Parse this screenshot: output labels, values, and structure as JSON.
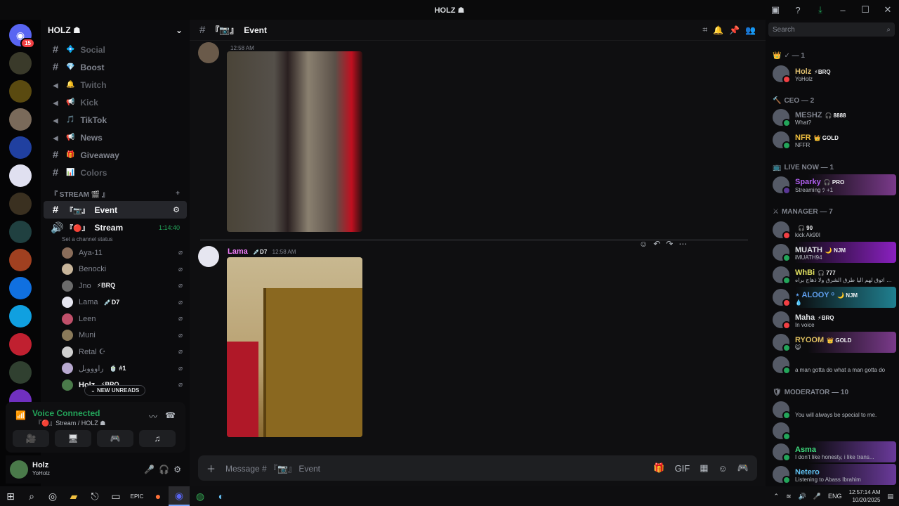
{
  "window": {
    "title": "HOLZ ☗"
  },
  "servers": {
    "discord_badge": "15",
    "items": [
      "home",
      "holz",
      "nfr",
      "server-3",
      "server-4",
      "server-5",
      "server-6",
      "server-7",
      "server-8",
      "server-9",
      "server-10",
      "server-11",
      "server-12",
      "server-13",
      "server-14",
      "server-15",
      "server-16",
      "server-17"
    ]
  },
  "guild": {
    "name": "HOLZ ☗"
  },
  "channels": [
    {
      "icon": "#",
      "emoji": "💠",
      "name": "Social",
      "active": false,
      "dim": true
    },
    {
      "icon": "#",
      "emoji": "💎",
      "name": "Boost",
      "active": false,
      "dim": false
    },
    {
      "icon": "📢",
      "emoji": "🔔",
      "name": "Twitch",
      "active": false,
      "dim": true
    },
    {
      "icon": "📢",
      "emoji": "📢",
      "name": "Kick",
      "active": false,
      "dim": true
    },
    {
      "icon": "📢",
      "emoji": "🎵",
      "name": "TikTok",
      "active": false,
      "dim": false
    },
    {
      "icon": "📢",
      "emoji": "📢",
      "name": "News",
      "active": false,
      "dim": false
    },
    {
      "icon": "#",
      "emoji": "🎁",
      "name": "Giveaway",
      "active": false,
      "dim": false
    },
    {
      "icon": "#",
      "emoji": "📊",
      "name": "Colors",
      "active": false,
      "dim": true
    }
  ],
  "stream_category": "『 STREAM 🎬 』",
  "event_channel": {
    "name": "Event",
    "prefix": "『📷』"
  },
  "stream_channel": {
    "name": "Stream",
    "prefix": "『🔴』",
    "time": "1:14:40",
    "status": "Set a channel status"
  },
  "voice_users": [
    {
      "name": "Aya-11",
      "tag": "",
      "color": "#8a6d5a"
    },
    {
      "name": "Benocki",
      "tag": "",
      "color": "#c8b59a"
    },
    {
      "name": "Jno",
      "tag": "⚡BRQ",
      "color": "#6b6b6b"
    },
    {
      "name": "Lama",
      "tag": "💉D7",
      "color": "#e6e6f0"
    },
    {
      "name": "Leen",
      "tag": "",
      "color": "#c0506a"
    },
    {
      "name": "Muni",
      "tag": "",
      "color": "#8a7a5a"
    },
    {
      "name": "Retal ☪︎",
      "tag": "",
      "color": "#d0d0d0"
    },
    {
      "name": "راوووبل",
      "tag": "🍵 #1",
      "color": "#b8a9d0"
    },
    {
      "name": "Holz",
      "tag": "⚡BRQ",
      "color": "#4a7a4a"
    }
  ],
  "new_unreads": "NEW UNREADS",
  "voice_connected": {
    "title": "Voice Connected",
    "subtitle": "『🔴』Stream / HOLZ ☗"
  },
  "user_panel": {
    "name": "Holz",
    "status": "YoHolz"
  },
  "header": {
    "channel": "Event",
    "prefix": "『📷』"
  },
  "messages": [
    {
      "time": "12:58 AM",
      "author": "",
      "avatar_color": "#6a5a4a"
    },
    {
      "time": "12:58 AM",
      "author": "Lama",
      "tag": "💉D7",
      "avatar_color": "#e6e6f0"
    }
  ],
  "composer": {
    "placeholder": "Message # 『📷』 Event"
  },
  "search": {
    "placeholder": "Search"
  },
  "members": {
    "groups": [
      {
        "label": "✓ — 1",
        "icon": "👑"
      },
      {
        "label": "CEO — 2",
        "icon": "🔨"
      },
      {
        "label": "LIVE NOW — 1",
        "icon": "📺"
      },
      {
        "label": "MANAGER — 7",
        "icon": "⚔"
      },
      {
        "label": "MODERATOR — 10",
        "icon": "🛡"
      }
    ],
    "list": [
      {
        "name": "Holz",
        "tag": "⚡BRQ",
        "sub": "YoHolz",
        "color": "#e0c070",
        "st": "#f23f43"
      },
      {
        "name": "MESHZ",
        "tag": "🎧 8888",
        "sub": "What?",
        "color": "#80848e",
        "st": "#23a55a"
      },
      {
        "name": "NFR",
        "tag": "👑 GOLD",
        "sub": "NFFR",
        "color": "#f0c040",
        "st": "#23a55a"
      },
      {
        "name": "Sparky",
        "tag": "🎧 PRO",
        "sub": "Streaming ﾂ +1",
        "color": "#b060f0",
        "st": "#593695"
      },
      {
        "name": "",
        "tag": "🎧 90",
        "sub": "kick Ak90I",
        "color": "#80848e",
        "st": "#f23f43"
      },
      {
        "name": "MUATH",
        "tag": "🌙 NJM",
        "sub": "iMUATH94",
        "color": "#dbdee1",
        "st": "#23a55a"
      },
      {
        "name": "WhBi",
        "tag": "🎧 777",
        "sub": "يم اني اتوق لهم اليا طرق الشرق ولا ذهاج براه",
        "color": "#e0e060",
        "st": "#23a55a"
      },
      {
        "name": "⋆ ALOOY ᵒ",
        "tag": "🌙 NJM",
        "sub": "💧",
        "color": "#60a0f0",
        "st": "#f23f43"
      },
      {
        "name": "Maha",
        "tag": "⚡BRQ",
        "sub": "In voice",
        "color": "#dbdee1",
        "st": "#f23f43"
      },
      {
        "name": "RYOOM",
        "tag": "👑 GOLD",
        "sub": "😺",
        "color": "#e0c060",
        "st": "#23a55a"
      },
      {
        "name": "",
        "tag": "",
        "sub": "a man gotta do what a man gotta do",
        "color": "#80848e",
        "st": "#23a55a"
      },
      {
        "name": "",
        "tag": "",
        "sub": "You will always be special to me.",
        "color": "#80848e",
        "st": "#23a55a"
      },
      {
        "name": "",
        "tag": "",
        "sub": "",
        "color": "#80848e",
        "st": "#23a55a"
      },
      {
        "name": "Asma",
        "tag": "",
        "sub": "I don't like honesty, i like trans...",
        "color": "#40e080",
        "st": "#23a55a"
      },
      {
        "name": "Netero",
        "tag": "",
        "sub": "Listening to Abass Ibrahim",
        "color": "#60c0f0",
        "st": "#23a55a"
      }
    ]
  },
  "taskbar": {
    "lang": "ENG",
    "time": "12:57:14 AM",
    "date": "10/20/2025"
  }
}
